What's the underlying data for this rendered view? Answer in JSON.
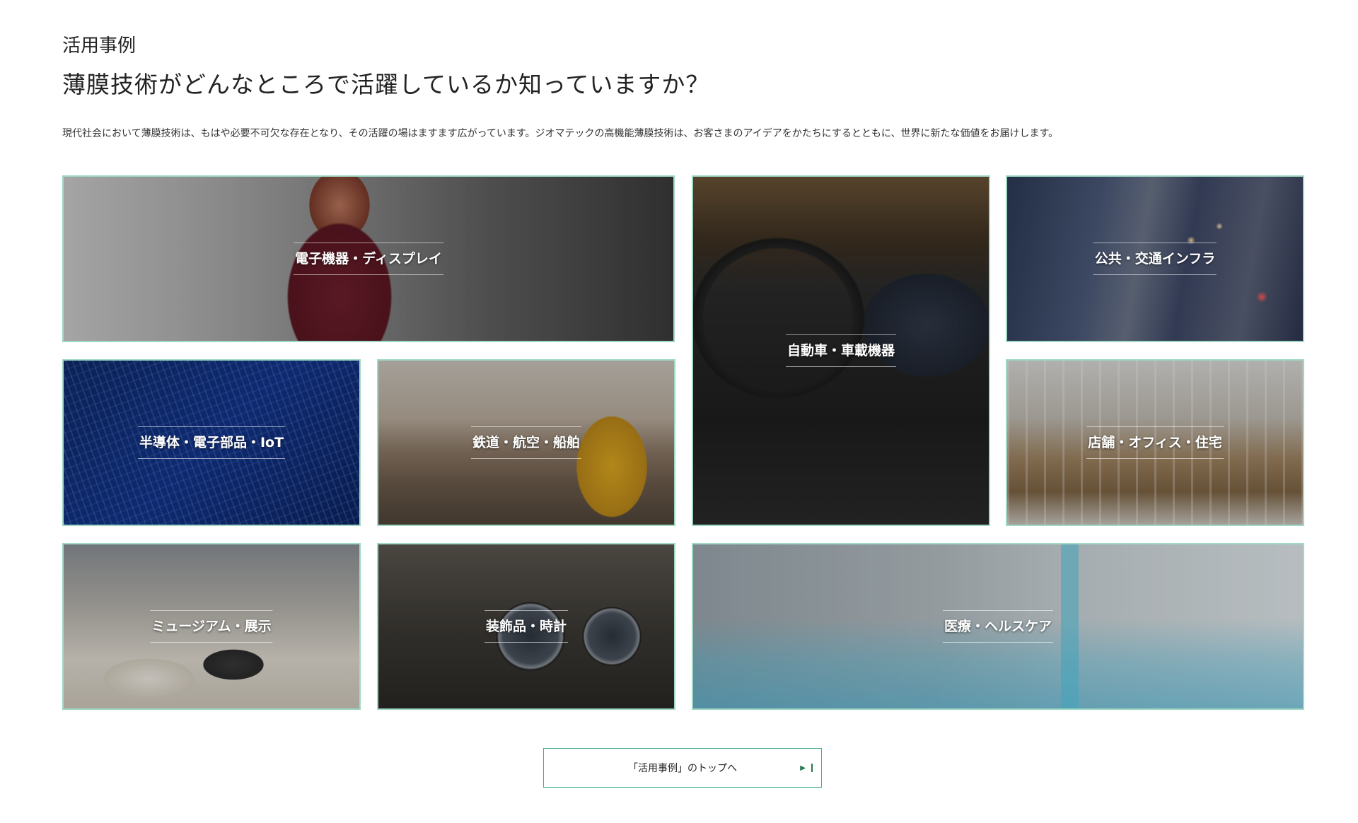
{
  "section": {
    "label": "活用事例",
    "headline": "薄膜技術がどんなところで活躍しているか知っていますか？",
    "intro": "現代社会において薄膜技術は、もはや必要不可欠な存在となり、その活躍の場はますます広がっています。ジオマテックの高機能薄膜技術は、お客さまのアイデアをかたちにするとともに、世界に新たな価値をお届けします。"
  },
  "tiles": [
    {
      "caption": "電子機器・ディスプレイ"
    },
    {
      "caption": "自動車・車載機器"
    },
    {
      "caption": "公共・交通インフラ"
    },
    {
      "caption": "半導体・電子部品・IoT"
    },
    {
      "caption": "鉄道・航空・船舶"
    },
    {
      "caption": "店舗・オフィス・住宅"
    },
    {
      "caption": "ミュージアム・展示"
    },
    {
      "caption": "装飾品・時計"
    },
    {
      "caption": "医療・ヘルスケア"
    }
  ],
  "cta": {
    "label": "「活用事例」のトップへ",
    "arrow_icon": "triangle-right-icon"
  },
  "colors": {
    "tile_border": "#9fd9c4",
    "cta_border": "#45b089",
    "arrow": "#1f7a4f"
  }
}
